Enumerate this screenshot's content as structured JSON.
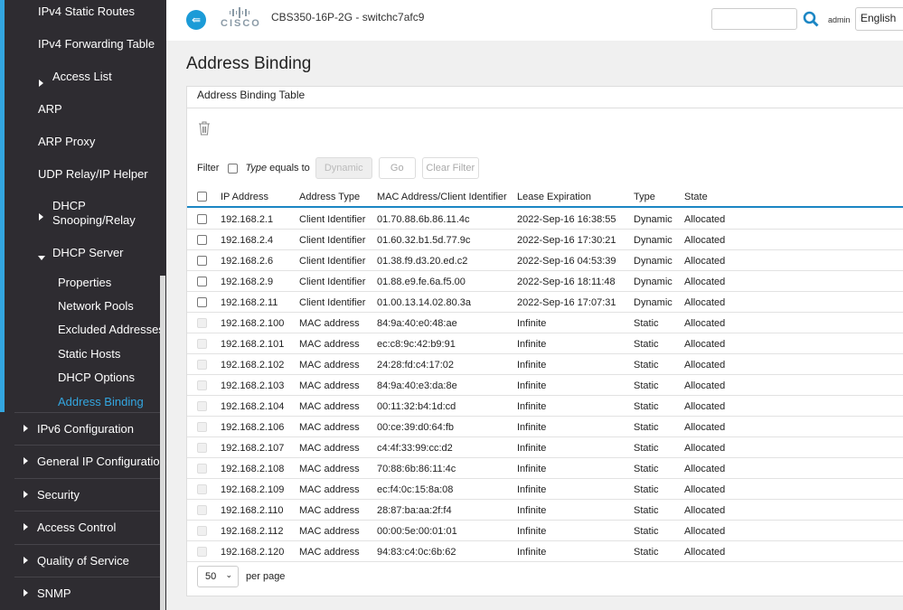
{
  "sidebar": {
    "items": [
      {
        "label": "IPv4 Static Routes"
      },
      {
        "label": "IPv4 Forwarding Table"
      },
      {
        "label": "Access List"
      },
      {
        "label": "ARP"
      },
      {
        "label": "ARP Proxy"
      },
      {
        "label": "UDP Relay/IP Helper"
      },
      {
        "label": "DHCP Snooping/Relay"
      },
      {
        "label": "DHCP Server"
      }
    ],
    "sub_items": [
      {
        "label": "Properties"
      },
      {
        "label": "Network Pools"
      },
      {
        "label": "Excluded Addresses"
      },
      {
        "label": "Static Hosts"
      },
      {
        "label": "DHCP Options"
      },
      {
        "label": "Address Binding",
        "active": true
      }
    ],
    "sections": [
      {
        "label": "IPv6 Configuration"
      },
      {
        "label": "General IP Configuration"
      },
      {
        "label": "Security"
      },
      {
        "label": "Access Control"
      },
      {
        "label": "Quality of Service"
      },
      {
        "label": "SNMP"
      }
    ],
    "accent_color": "#33a6e0"
  },
  "header": {
    "logo": "cisco",
    "device": "CBS350-16P-2G - switchc7afc9",
    "search_placeholder": "",
    "user": "admin",
    "language": "English"
  },
  "page": {
    "title": "Address Binding",
    "card_title": "Address Binding Table"
  },
  "filter": {
    "label": "Filter",
    "field": "Type",
    "op": "equals to",
    "value": "Dynamic",
    "go": "Go",
    "clear": "Clear Filter"
  },
  "table": {
    "columns": [
      "IP Address",
      "Address Type",
      "MAC Address/Client Identifier",
      "Lease Expiration",
      "Type",
      "State"
    ],
    "rows": [
      [
        "192.168.2.1",
        "Client Identifier",
        "01.70.88.6b.86.11.4c",
        "2022-Sep-16 16:38:55",
        "Dynamic",
        "Allocated"
      ],
      [
        "192.168.2.4",
        "Client Identifier",
        "01.60.32.b1.5d.77.9c",
        "2022-Sep-16 17:30:21",
        "Dynamic",
        "Allocated"
      ],
      [
        "192.168.2.6",
        "Client Identifier",
        "01.38.f9.d3.20.ed.c2",
        "2022-Sep-16 04:53:39",
        "Dynamic",
        "Allocated"
      ],
      [
        "192.168.2.9",
        "Client Identifier",
        "01.88.e9.fe.6a.f5.00",
        "2022-Sep-16 18:11:48",
        "Dynamic",
        "Allocated"
      ],
      [
        "192.168.2.11",
        "Client Identifier",
        "01.00.13.14.02.80.3a",
        "2022-Sep-16 17:07:31",
        "Dynamic",
        "Allocated"
      ],
      [
        "192.168.2.100",
        "MAC address",
        "84:9a:40:e0:48:ae",
        "Infinite",
        "Static",
        "Allocated"
      ],
      [
        "192.168.2.101",
        "MAC address",
        "ec:c8:9c:42:b9:91",
        "Infinite",
        "Static",
        "Allocated"
      ],
      [
        "192.168.2.102",
        "MAC address",
        "24:28:fd:c4:17:02",
        "Infinite",
        "Static",
        "Allocated"
      ],
      [
        "192.168.2.103",
        "MAC address",
        "84:9a:40:e3:da:8e",
        "Infinite",
        "Static",
        "Allocated"
      ],
      [
        "192.168.2.104",
        "MAC address",
        "00:11:32:b4:1d:cd",
        "Infinite",
        "Static",
        "Allocated"
      ],
      [
        "192.168.2.106",
        "MAC address",
        "00:ce:39:d0:64:fb",
        "Infinite",
        "Static",
        "Allocated"
      ],
      [
        "192.168.2.107",
        "MAC address",
        "c4:4f:33:99:cc:d2",
        "Infinite",
        "Static",
        "Allocated"
      ],
      [
        "192.168.2.108",
        "MAC address",
        "70:88:6b:86:11:4c",
        "Infinite",
        "Static",
        "Allocated"
      ],
      [
        "192.168.2.109",
        "MAC address",
        "ec:f4:0c:15:8a:08",
        "Infinite",
        "Static",
        "Allocated"
      ],
      [
        "192.168.2.110",
        "MAC address",
        "28:87:ba:aa:2f:f4",
        "Infinite",
        "Static",
        "Allocated"
      ],
      [
        "192.168.2.112",
        "MAC address",
        "00:00:5e:00:01:01",
        "Infinite",
        "Static",
        "Allocated"
      ],
      [
        "192.168.2.120",
        "MAC address",
        "94:83:c4:0c:6b:62",
        "Infinite",
        "Static",
        "Allocated"
      ]
    ]
  },
  "pager": {
    "per_page": "50",
    "per_page_label": "per page"
  }
}
